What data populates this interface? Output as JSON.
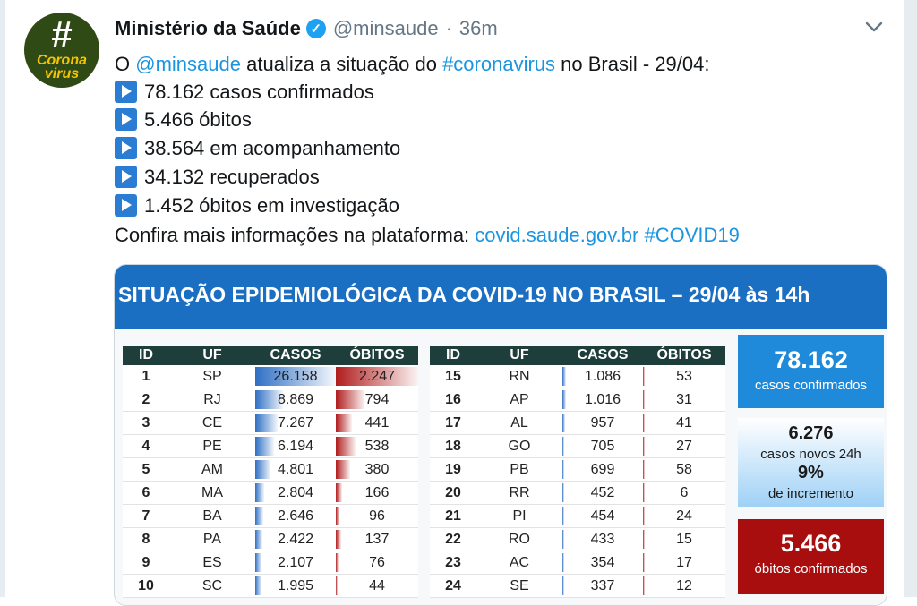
{
  "tweet": {
    "author": "Ministério da Saúde",
    "handle": "@minsaude",
    "separator": "·",
    "time": "36m",
    "avatar_text": {
      "hash": "#",
      "line1": "Corona",
      "line2": "virus"
    },
    "line0": {
      "prefix": "O",
      "mention": "@minsaude",
      "middle": "atualiza a situação do",
      "hashtag": "#coronavirus",
      "suffix": "no Brasil - 29/04:"
    },
    "bullets": [
      "78.162 casos confirmados",
      "5.466 óbitos",
      "38.564 em acompanhamento",
      "34.132 recuperados",
      "1.452 óbitos em investigação"
    ],
    "more": {
      "prefix": "Confira mais informações na plataforma:",
      "link": "covid.saude.gov.br",
      "hashtag": "#COVID19"
    }
  },
  "card": {
    "title": "SITUAÇÃO EPIDEMIOLÓGICA DA COVID-19 NO BRASIL – 29/04 às 14h",
    "columns": [
      "ID",
      "UF",
      "CASOS",
      "ÓBITOS"
    ],
    "left_rows": [
      {
        "id": "1",
        "uf": "SP",
        "casos": "26.158",
        "obitos": "2.247",
        "casos_frac": 1.0,
        "obitos_frac": 1.0
      },
      {
        "id": "2",
        "uf": "RJ",
        "casos": "8.869",
        "obitos": "794",
        "casos_frac": 0.339,
        "obitos_frac": 0.353
      },
      {
        "id": "3",
        "uf": "CE",
        "casos": "7.267",
        "obitos": "441",
        "casos_frac": 0.278,
        "obitos_frac": 0.196
      },
      {
        "id": "4",
        "uf": "PE",
        "casos": "6.194",
        "obitos": "538",
        "casos_frac": 0.237,
        "obitos_frac": 0.239
      },
      {
        "id": "5",
        "uf": "AM",
        "casos": "4.801",
        "obitos": "380",
        "casos_frac": 0.184,
        "obitos_frac": 0.169
      },
      {
        "id": "6",
        "uf": "MA",
        "casos": "2.804",
        "obitos": "166",
        "casos_frac": 0.107,
        "obitos_frac": 0.074
      },
      {
        "id": "7",
        "uf": "BA",
        "casos": "2.646",
        "obitos": "96",
        "casos_frac": 0.101,
        "obitos_frac": 0.043
      },
      {
        "id": "8",
        "uf": "PA",
        "casos": "2.422",
        "obitos": "137",
        "casos_frac": 0.093,
        "obitos_frac": 0.061
      },
      {
        "id": "9",
        "uf": "ES",
        "casos": "2.107",
        "obitos": "76",
        "casos_frac": 0.081,
        "obitos_frac": 0.034
      },
      {
        "id": "10",
        "uf": "SC",
        "casos": "1.995",
        "obitos": "44",
        "casos_frac": 0.076,
        "obitos_frac": 0.02
      }
    ],
    "right_rows": [
      {
        "id": "15",
        "uf": "RN",
        "casos": "1.086",
        "obitos": "53",
        "casos_frac": 0.042,
        "obitos_frac": 0.024
      },
      {
        "id": "16",
        "uf": "AP",
        "casos": "1.016",
        "obitos": "31",
        "casos_frac": 0.039,
        "obitos_frac": 0.014
      },
      {
        "id": "17",
        "uf": "AL",
        "casos": "957",
        "obitos": "41",
        "casos_frac": 0.037,
        "obitos_frac": 0.018
      },
      {
        "id": "18",
        "uf": "GO",
        "casos": "705",
        "obitos": "27",
        "casos_frac": 0.027,
        "obitos_frac": 0.012
      },
      {
        "id": "19",
        "uf": "PB",
        "casos": "699",
        "obitos": "58",
        "casos_frac": 0.027,
        "obitos_frac": 0.026
      },
      {
        "id": "20",
        "uf": "RR",
        "casos": "452",
        "obitos": "6",
        "casos_frac": 0.017,
        "obitos_frac": 0.003
      },
      {
        "id": "21",
        "uf": "PI",
        "casos": "454",
        "obitos": "24",
        "casos_frac": 0.017,
        "obitos_frac": 0.011
      },
      {
        "id": "22",
        "uf": "RO",
        "casos": "433",
        "obitos": "15",
        "casos_frac": 0.017,
        "obitos_frac": 0.007
      },
      {
        "id": "23",
        "uf": "AC",
        "casos": "354",
        "obitos": "17",
        "casos_frac": 0.014,
        "obitos_frac": 0.008
      },
      {
        "id": "24",
        "uf": "SE",
        "casos": "337",
        "obitos": "12",
        "casos_frac": 0.013,
        "obitos_frac": 0.005
      }
    ],
    "stat_confirmed": {
      "value": "78.162",
      "label": "casos confirmados"
    },
    "stat_new": {
      "value": "6.276",
      "label": "casos novos 24h",
      "pct": "9%",
      "pct_label": "de incremento"
    },
    "stat_deaths": {
      "value": "5.466",
      "label": "óbitos confirmados"
    }
  },
  "colors": {
    "link": "#1b95e0",
    "banner": "#1b6fc3",
    "table_header": "#1d3e3a",
    "casos_bar": "#2f6fc4",
    "obitos_bar": "#b01c1c",
    "deaths_box": "#a80e0e",
    "confirmed_box": "#1f8ad9"
  },
  "icons": {
    "verified": "verified-badge-icon",
    "menu": "chevron-down-icon",
    "bullet": "play-button-icon"
  }
}
